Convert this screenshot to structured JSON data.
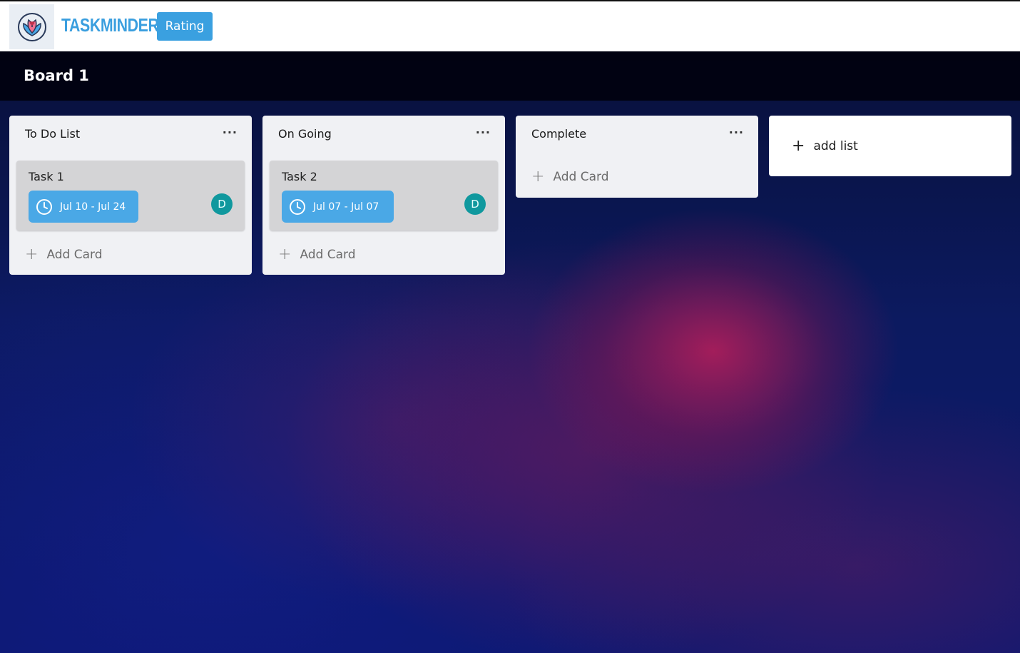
{
  "header": {
    "brand": "TASKMINDER",
    "rating_label": "Rating"
  },
  "board": {
    "title": "Board 1"
  },
  "lists": [
    {
      "title": "To Do List",
      "menu": "···",
      "cards": [
        {
          "title": "Task 1",
          "dates": "Jul 10 - Jul 24",
          "avatar": "D"
        }
      ],
      "add_card": "Add Card"
    },
    {
      "title": "On Going",
      "menu": "···",
      "cards": [
        {
          "title": "Task 2",
          "dates": "Jul 07 - Jul 07",
          "avatar": "D"
        }
      ],
      "add_card": "Add Card"
    },
    {
      "title": "Complete",
      "menu": "···",
      "cards": [],
      "add_card": "Add Card"
    }
  ],
  "add_list": "add list",
  "colors": {
    "accent": "#3aa0e0",
    "badge": "#4aa8e6",
    "avatar": "#10989e",
    "list_bg": "#f0f1f4"
  }
}
